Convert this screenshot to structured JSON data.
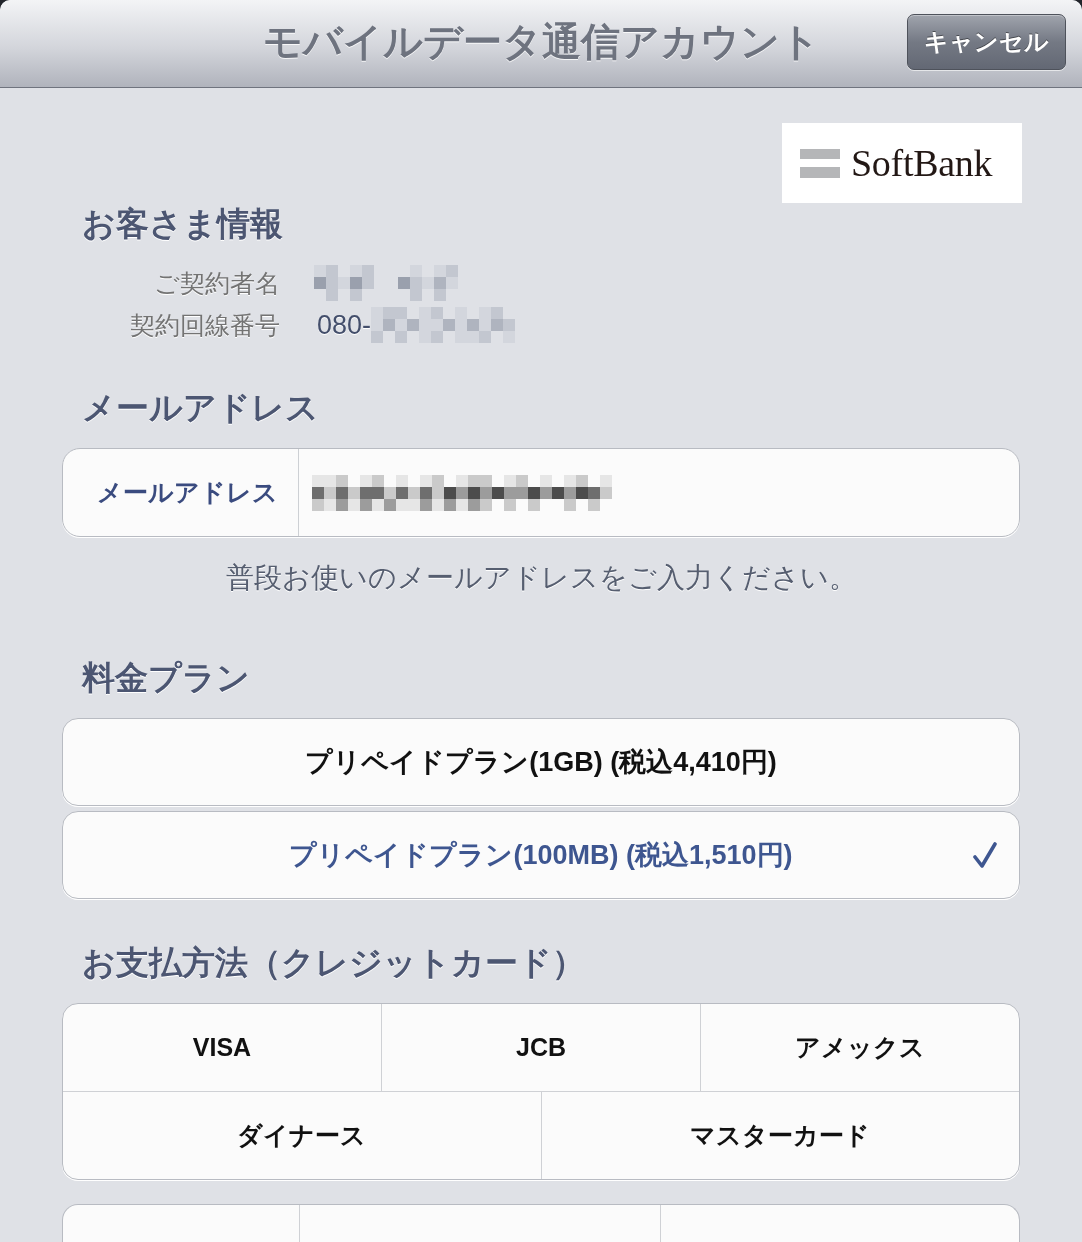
{
  "nav_bar": {
    "title": "モバイルデータ通信アカウント",
    "cancel_button": "キャンセル"
  },
  "logo": {
    "text": "SoftBank"
  },
  "customer_info": {
    "heading": "お客さま情報",
    "rows": [
      {
        "label": "ご契約者名"
      },
      {
        "label": "契約回線番号",
        "value": "080-"
      }
    ]
  },
  "email": {
    "heading": "メールアドレス",
    "field_label": "メールアドレス",
    "hint": "普段お使いのメールアドレスをご入力ください。"
  },
  "plans": {
    "heading": "料金プラン",
    "options": [
      {
        "label": "プリペイドプラン(1GB) (税込4,410円)",
        "selected": false
      },
      {
        "label": "プリペイドプラン(100MB) (税込1,510円)",
        "selected": true
      }
    ]
  },
  "payment": {
    "heading": "お支払方法（クレジットカード）",
    "rows": [
      {
        "options": [
          {
            "label": "VISA",
            "selected": false
          },
          {
            "label": "JCB",
            "selected": false
          },
          {
            "label": "アメックス",
            "selected": false
          }
        ]
      },
      {
        "options": [
          {
            "label": "ダイナース",
            "selected": false
          },
          {
            "label": "マスターカード",
            "selected": false
          }
        ]
      }
    ]
  }
}
